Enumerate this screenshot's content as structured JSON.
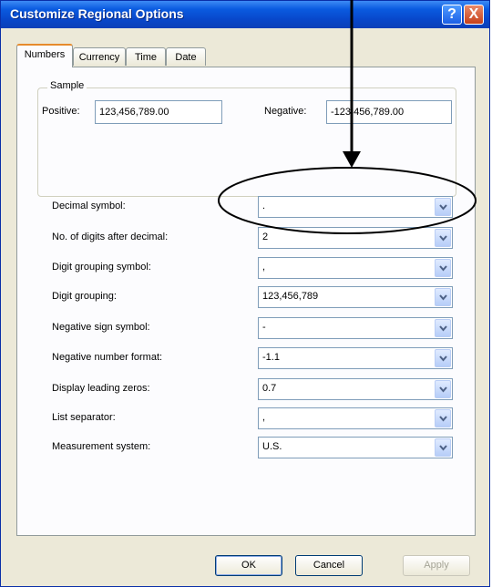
{
  "window": {
    "title": "Customize Regional Options",
    "help_glyph": "?",
    "close_glyph": "X"
  },
  "tabs": [
    {
      "label": "Numbers"
    },
    {
      "label": "Currency"
    },
    {
      "label": "Time"
    },
    {
      "label": "Date"
    }
  ],
  "active_tab": "Numbers",
  "sample": {
    "legend": "Sample",
    "positive_label": "Positive:",
    "positive_value": "123,456,789.00",
    "negative_label": "Negative:",
    "negative_value": "-123,456,789.00"
  },
  "settings": [
    {
      "label": "Decimal symbol:",
      "value": "."
    },
    {
      "label": "No. of digits after decimal:",
      "value": "2"
    },
    {
      "label": "Digit grouping symbol:",
      "value": ","
    },
    {
      "label": "Digit grouping:",
      "value": "123,456,789"
    },
    {
      "label": "Negative sign symbol:",
      "value": "-"
    },
    {
      "label": "Negative number format:",
      "value": "-1.1"
    },
    {
      "label": "Display leading zeros:",
      "value": "0.7"
    },
    {
      "label": "List separator:",
      "value": ","
    },
    {
      "label": "Measurement system:",
      "value": "U.S."
    }
  ],
  "buttons": {
    "ok": "OK",
    "cancel": "Cancel",
    "apply": "Apply"
  },
  "colors": {
    "title_bar": "#0a5be0",
    "annotation": "#000000",
    "active_tab_accent": "#e68b2c"
  }
}
